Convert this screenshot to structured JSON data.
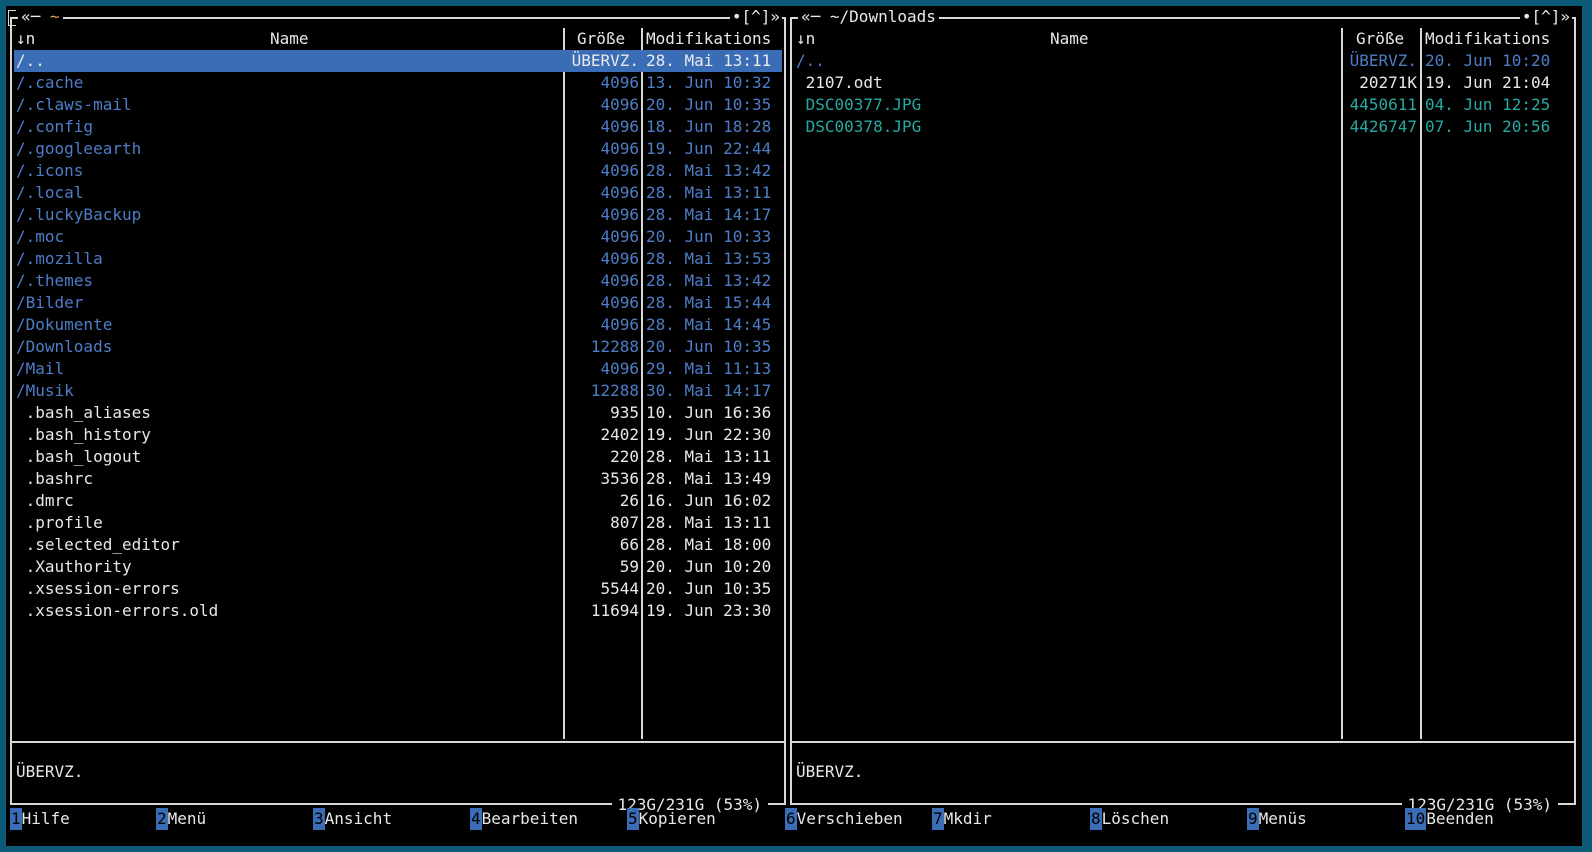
{
  "left_panel": {
    "title_prefix": "«─ ",
    "path": "~",
    "controls": "•[^]»",
    "sort_indicator": "↓n",
    "col_name": "Name",
    "col_size": "Größe",
    "col_mtime": "Modifikations",
    "rows": [
      {
        "name": "/..",
        "size": "ÜBERVZ.",
        "mtime": "28. Mai 13:11",
        "kind": "selected"
      },
      {
        "name": "/.cache",
        "size": "4096",
        "mtime": "13. Jun 10:32",
        "kind": "dir"
      },
      {
        "name": "/.claws-mail",
        "size": "4096",
        "mtime": "20. Jun 10:35",
        "kind": "dir"
      },
      {
        "name": "/.config",
        "size": "4096",
        "mtime": "18. Jun 18:28",
        "kind": "dir"
      },
      {
        "name": "/.googleearth",
        "size": "4096",
        "mtime": "19. Jun 22:44",
        "kind": "dir"
      },
      {
        "name": "/.icons",
        "size": "4096",
        "mtime": "28. Mai 13:42",
        "kind": "dir"
      },
      {
        "name": "/.local",
        "size": "4096",
        "mtime": "28. Mai 13:11",
        "kind": "dir"
      },
      {
        "name": "/.luckyBackup",
        "size": "4096",
        "mtime": "28. Mai 14:17",
        "kind": "dir"
      },
      {
        "name": "/.moc",
        "size": "4096",
        "mtime": "20. Jun 10:33",
        "kind": "dir"
      },
      {
        "name": "/.mozilla",
        "size": "4096",
        "mtime": "28. Mai 13:53",
        "kind": "dir"
      },
      {
        "name": "/.themes",
        "size": "4096",
        "mtime": "28. Mai 13:42",
        "kind": "dir"
      },
      {
        "name": "/Bilder",
        "size": "4096",
        "mtime": "28. Mai 15:44",
        "kind": "dir"
      },
      {
        "name": "/Dokumente",
        "size": "4096",
        "mtime": "28. Mai 14:45",
        "kind": "dir"
      },
      {
        "name": "/Downloads",
        "size": "12288",
        "mtime": "20. Jun 10:35",
        "kind": "dir"
      },
      {
        "name": "/Mail",
        "size": "4096",
        "mtime": "29. Mai 11:13",
        "kind": "dir"
      },
      {
        "name": "/Musik",
        "size": "12288",
        "mtime": "30. Mai 14:17",
        "kind": "dir"
      },
      {
        "name": " .bash_aliases",
        "size": "935",
        "mtime": "10. Jun 16:36",
        "kind": "file"
      },
      {
        "name": " .bash_history",
        "size": "2402",
        "mtime": "19. Jun 22:30",
        "kind": "file"
      },
      {
        "name": " .bash_logout",
        "size": "220",
        "mtime": "28. Mai 13:11",
        "kind": "file"
      },
      {
        "name": " .bashrc",
        "size": "3536",
        "mtime": "28. Mai 13:49",
        "kind": "file"
      },
      {
        "name": " .dmrc",
        "size": "26",
        "mtime": "16. Jun 16:02",
        "kind": "file"
      },
      {
        "name": " .profile",
        "size": "807",
        "mtime": "28. Mai 13:11",
        "kind": "file"
      },
      {
        "name": " .selected_editor",
        "size": "66",
        "mtime": "28. Mai 18:00",
        "kind": "file"
      },
      {
        "name": " .Xauthority",
        "size": "59",
        "mtime": "20. Jun 10:20",
        "kind": "file"
      },
      {
        "name": " .xsession-errors",
        "size": "5544",
        "mtime": "20. Jun 10:35",
        "kind": "file"
      },
      {
        "name": " .xsession-errors.old",
        "size": "11694",
        "mtime": "19. Jun 23:30",
        "kind": "file"
      }
    ],
    "mini_status": "ÜBERVZ.",
    "disk_info": "123G/231G (53%)"
  },
  "right_panel": {
    "title_prefix": "«─ ",
    "path": "~/Downloads",
    "controls": "•[^]»",
    "sort_indicator": "↓n",
    "col_name": "Name",
    "col_size": "Größe",
    "col_mtime": "Modifikations",
    "rows": [
      {
        "name": "/..",
        "size": "ÜBERVZ.",
        "mtime": "20. Jun 10:20",
        "kind": "dir"
      },
      {
        "name": " 2107.odt",
        "size": "20271K",
        "mtime": "19. Jun 21:04",
        "kind": "file"
      },
      {
        "name": " DSC00377.JPG",
        "size": "4450611",
        "mtime": "04. Jun 12:25",
        "kind": "img"
      },
      {
        "name": " DSC00378.JPG",
        "size": "4426747",
        "mtime": "07. Jun 20:56",
        "kind": "img"
      }
    ],
    "mini_status": "ÜBERVZ.",
    "disk_info": "123G/231G (53%)"
  },
  "function_keys": [
    {
      "num": "1",
      "label": "Hilfe"
    },
    {
      "num": "2",
      "label": "Menü"
    },
    {
      "num": "3",
      "label": "Ansicht"
    },
    {
      "num": "4",
      "label": "Bearbeiten"
    },
    {
      "num": "5",
      "label": "Kopieren"
    },
    {
      "num": "6",
      "label": "Verschieben"
    },
    {
      "num": "7",
      "label": "Mkdir"
    },
    {
      "num": "8",
      "label": "Löschen"
    },
    {
      "num": "9",
      "label": "Menüs"
    },
    {
      "num": "10",
      "label": "Beenden"
    }
  ],
  "colors": {
    "dir": "#4e7dc8",
    "image": "#27a9a3",
    "selection": "#3b6db6",
    "home_path": "#e2a94a"
  }
}
